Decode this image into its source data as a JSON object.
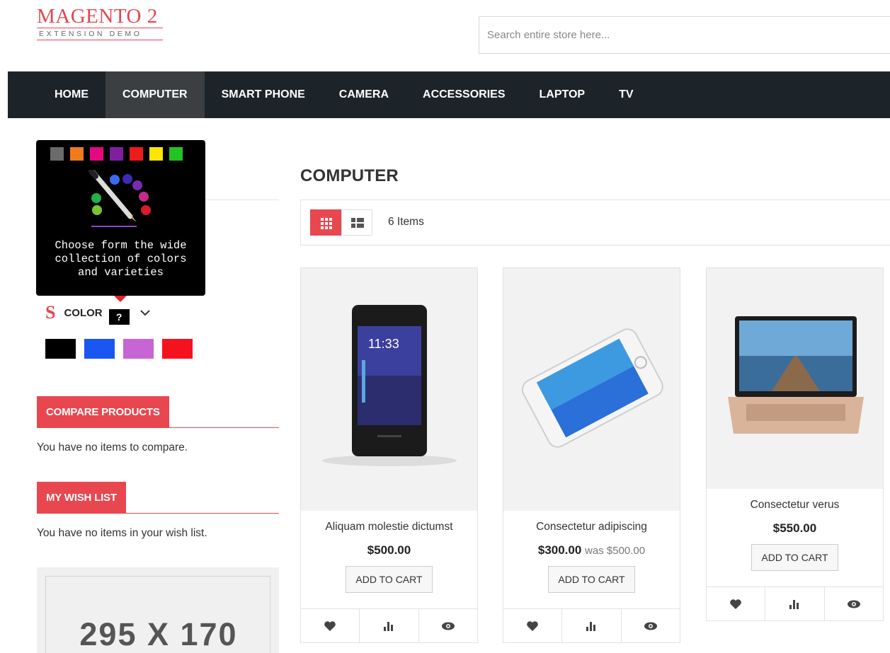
{
  "logo": {
    "main": "MAGENTO 2",
    "sub": "EXTENSION DEMO"
  },
  "search": {
    "placeholder": "Search entire store here..."
  },
  "nav": {
    "items": [
      {
        "label": "HOME"
      },
      {
        "label": "COMPUTER"
      },
      {
        "label": "SMART PHONE"
      },
      {
        "label": "CAMERA"
      },
      {
        "label": "ACCESSORIES"
      },
      {
        "label": "LAPTOP"
      },
      {
        "label": "TV"
      }
    ],
    "active": "COMPUTER"
  },
  "tooltip": {
    "swatches": [
      "#6b6b6b",
      "#f07b1a",
      "#e5087f",
      "#7f1fa0",
      "#ee1b1b",
      "#ffe600",
      "#22c422"
    ],
    "text_lines": [
      "Choose form the wide",
      "collection of colors",
      "and varieties"
    ]
  },
  "color_filter": {
    "label": "COLOR",
    "help": "?",
    "swatches": [
      "#000000",
      "#1a56f0",
      "#c865d4",
      "#f5121f"
    ]
  },
  "compare": {
    "title": "COMPARE PRODUCTS",
    "empty_text": "You have no items to compare."
  },
  "wishlist": {
    "title": "MY WISH LIST",
    "empty_text": "You have no items in your wish list."
  },
  "placeholder_banner": {
    "text": "295 X 170"
  },
  "main": {
    "title": "COMPUTER",
    "items_count": "6 Items",
    "products": [
      {
        "name": "Aliquam molestie dictumst",
        "price": "$500.00",
        "was": "",
        "button": "ADD TO CART"
      },
      {
        "name": "Consectetur adipiscing",
        "price": "$300.00",
        "was": "was $500.00",
        "button": "ADD TO CART"
      },
      {
        "name": "Consectetur verus",
        "price": "$550.00",
        "was": "",
        "button": "ADD TO CART"
      }
    ]
  },
  "colors": {
    "accent": "#e8474f",
    "nav_bg": "#1d2429",
    "nav_active": "#3b3f42"
  },
  "icons": [
    "heart-icon",
    "compare-icon",
    "eye-icon",
    "grid-view-icon",
    "list-view-icon",
    "chevron-down-icon"
  ]
}
